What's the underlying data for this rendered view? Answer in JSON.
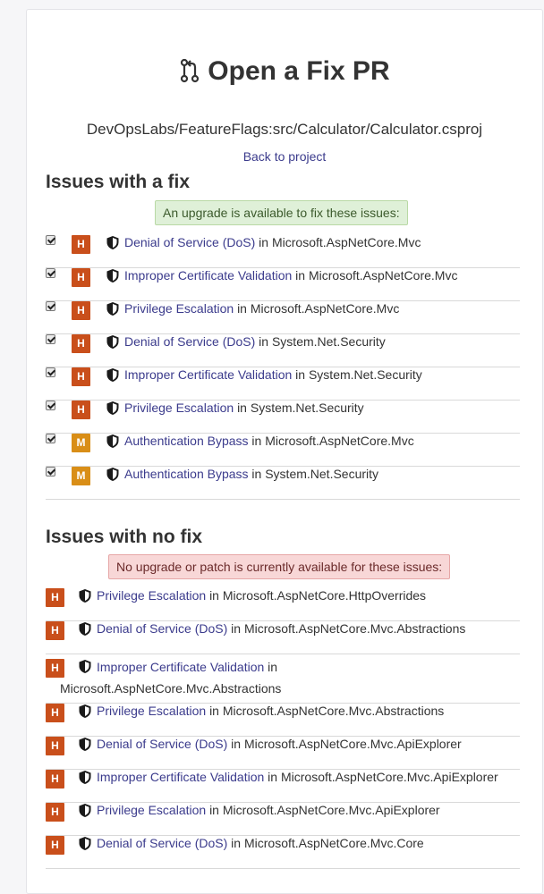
{
  "page": {
    "title": "Open a Fix PR",
    "project_path": "DevOpsLabs/FeatureFlags:src/Calculator/Calculator.csproj",
    "back_link": "Back to project",
    "in_word": "in"
  },
  "with_fix": {
    "heading": "Issues with a fix",
    "notice": "An upgrade is available to fix these issues:",
    "items": [
      {
        "severity": "H",
        "title": "Denial of Service (DoS)",
        "package": "Microsoft.AspNetCore.Mvc",
        "checked": true
      },
      {
        "severity": "H",
        "title": "Improper Certificate Validation",
        "package": "Microsoft.AspNetCore.Mvc",
        "checked": true
      },
      {
        "severity": "H",
        "title": "Privilege Escalation",
        "package": "Microsoft.AspNetCore.Mvc",
        "checked": true
      },
      {
        "severity": "H",
        "title": "Denial of Service (DoS)",
        "package": "System.Net.Security",
        "checked": true
      },
      {
        "severity": "H",
        "title": "Improper Certificate Validation",
        "package": "System.Net.Security",
        "checked": true
      },
      {
        "severity": "H",
        "title": "Privilege Escalation",
        "package": "System.Net.Security",
        "checked": true
      },
      {
        "severity": "M",
        "title": "Authentication Bypass",
        "package": "Microsoft.AspNetCore.Mvc",
        "checked": true
      },
      {
        "severity": "M",
        "title": "Authentication Bypass",
        "package": "System.Net.Security",
        "checked": true
      }
    ]
  },
  "no_fix": {
    "heading": "Issues with no fix",
    "notice": "No upgrade or patch is currently available for these issues:",
    "items": [
      {
        "severity": "H",
        "title": "Privilege Escalation",
        "package": "Microsoft.AspNetCore.HttpOverrides"
      },
      {
        "severity": "H",
        "title": "Denial of Service (DoS)",
        "package": "Microsoft.AspNetCore.Mvc.Abstractions"
      },
      {
        "severity": "H",
        "title": "Improper Certificate Validation",
        "package": "Microsoft.AspNetCore.Mvc.Abstractions"
      },
      {
        "severity": "H",
        "title": "Privilege Escalation",
        "package": "Microsoft.AspNetCore.Mvc.Abstractions"
      },
      {
        "severity": "H",
        "title": "Denial of Service (DoS)",
        "package": "Microsoft.AspNetCore.Mvc.ApiExplorer"
      },
      {
        "severity": "H",
        "title": "Improper Certificate Validation",
        "package": "Microsoft.AspNetCore.Mvc.ApiExplorer"
      },
      {
        "severity": "H",
        "title": "Privilege Escalation",
        "package": "Microsoft.AspNetCore.Mvc.ApiExplorer"
      },
      {
        "severity": "H",
        "title": "Denial of Service (DoS)",
        "package": "Microsoft.AspNetCore.Mvc.Core"
      }
    ]
  },
  "colors": {
    "severity_high": "#c94f1b",
    "severity_medium": "#d98e17",
    "link": "#3b3b8c"
  }
}
